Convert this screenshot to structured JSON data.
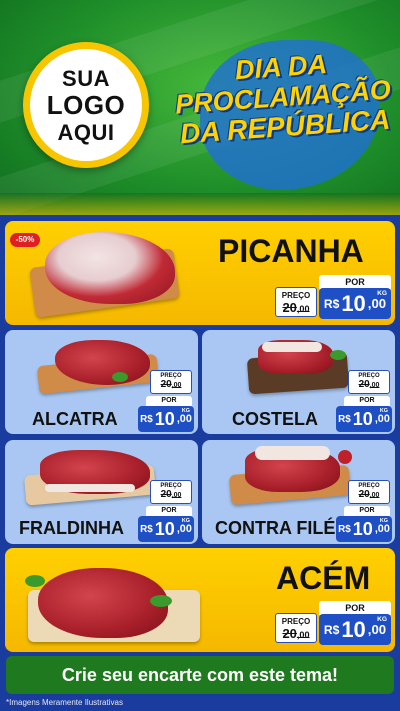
{
  "header": {
    "logo_line1": "SUA",
    "logo_line2": "LOGO",
    "logo_line3": "AQUI",
    "title_line1": "DIA DA",
    "title_line2": "PROCLAMAÇÃO",
    "title_line3": "DA REPÚBLICA"
  },
  "products": [
    {
      "name": "PICANHA",
      "discount": "-50%",
      "de_label": "PREÇO",
      "de_price": "20",
      "de_cents": ",00",
      "por_label": "POR",
      "currency": "R$",
      "price": "10",
      "cents": ",00",
      "unit": "KG"
    },
    {
      "name": "ALCATRA",
      "de_label": "PREÇO",
      "de_price": "20",
      "de_cents": ",00",
      "por_label": "POR",
      "currency": "R$",
      "price": "10",
      "cents": ",00",
      "unit": "KG"
    },
    {
      "name": "COSTELA",
      "de_label": "PREÇO",
      "de_price": "20",
      "de_cents": ",00",
      "por_label": "POR",
      "currency": "R$",
      "price": "10",
      "cents": ",00",
      "unit": "KG"
    },
    {
      "name": "FRALDINHA",
      "de_label": "PREÇO",
      "de_price": "20",
      "de_cents": ",00",
      "por_label": "POR",
      "currency": "R$",
      "price": "10",
      "cents": ",00",
      "unit": "KG"
    },
    {
      "name": "CONTRA FILÉ",
      "de_label": "PREÇO",
      "de_price": "20",
      "de_cents": ",00",
      "por_label": "POR",
      "currency": "R$",
      "price": "10",
      "cents": ",00",
      "unit": "KG"
    },
    {
      "name": "ACÉM",
      "de_label": "PREÇO",
      "de_price": "20",
      "de_cents": ",00",
      "por_label": "POR",
      "currency": "R$",
      "price": "10",
      "cents": ",00",
      "unit": "KG"
    }
  ],
  "cta": "Crie seu encarte com este tema!",
  "disclaimer": "*Imagens Meramente Ilustrativas",
  "colors": {
    "background": "#1a3c9e",
    "header_green": "#1f8f2a",
    "yellow": "#ffd000",
    "light_blue": "#a9c7f2",
    "price_blue": "#1f4fc4",
    "cta_green": "#1f7a1f",
    "discount_red": "#e02020"
  }
}
